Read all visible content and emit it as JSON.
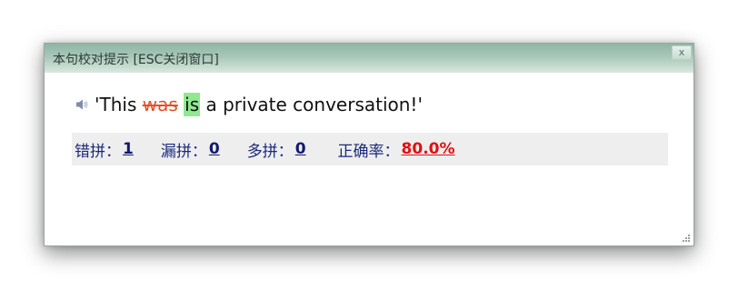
{
  "window": {
    "title": "本句校对提示 [ESC关闭窗口]",
    "close_label": "x"
  },
  "sentence": {
    "open_quote": "'This ",
    "wrong_word": "was",
    "space": " ",
    "correct_word": "is",
    "rest": " a private conversation!'",
    "speaker_icon": "speaker-icon"
  },
  "stats": {
    "misspelled_label": "错拼：",
    "misspelled_value": "1",
    "missing_label": "漏拼：",
    "missing_value": "0",
    "extra_label": "多拼：",
    "extra_value": "0",
    "accuracy_label": "正确率：",
    "accuracy_value": "80.0%"
  },
  "colors": {
    "wrong_word": "#e0522a",
    "correct_highlight": "#90e890",
    "accuracy_value": "#e01010",
    "stats_text": "#1a2a7a"
  }
}
